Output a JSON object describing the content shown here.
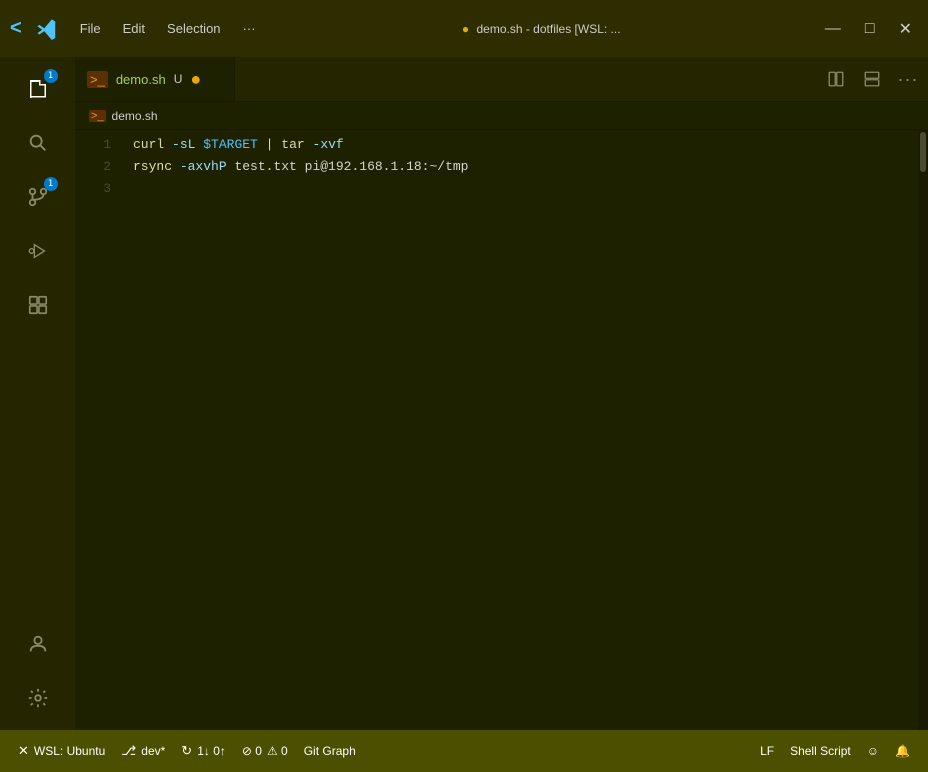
{
  "titlebar": {
    "logo": "⟩_",
    "menu": {
      "file": "File",
      "edit": "Edit",
      "selection": "Selection",
      "more": "···"
    },
    "title_dot": "●",
    "title_text": "demo.sh - dotfiles [WSL: ...",
    "controls": {
      "minimize": "—",
      "maximize": "□",
      "close": "✕"
    }
  },
  "activity_bar": {
    "icons": [
      {
        "name": "explorer-icon",
        "symbol": "📄",
        "badge": null
      },
      {
        "name": "search-icon",
        "symbol": "🔍",
        "badge": null
      },
      {
        "name": "source-control-icon",
        "symbol": "⑂",
        "badge": "1"
      },
      {
        "name": "run-debug-icon",
        "symbol": "▷",
        "badge": null
      },
      {
        "name": "extensions-icon",
        "symbol": "⋯",
        "badge": null
      }
    ],
    "bottom_icons": [
      {
        "name": "account-icon",
        "symbol": "👤",
        "badge": null
      },
      {
        "name": "settings-icon",
        "symbol": "⚙",
        "badge": null
      }
    ]
  },
  "tab_bar": {
    "tab": {
      "icon": ">_",
      "name": "demo.sh",
      "badge": "U",
      "dot": "●"
    },
    "actions": {
      "split_editor": "⧉",
      "layout": "⊞",
      "more": "···"
    }
  },
  "breadcrumb": {
    "icon": ">_",
    "filename": "demo.sh"
  },
  "editor": {
    "lines": [
      {
        "number": "1",
        "tokens": [
          {
            "type": "cmd",
            "text": "curl"
          },
          {
            "type": "plain",
            "text": " "
          },
          {
            "type": "flag",
            "text": "-sL"
          },
          {
            "type": "plain",
            "text": " "
          },
          {
            "type": "var",
            "text": "$TARGET"
          },
          {
            "type": "plain",
            "text": " "
          },
          {
            "type": "pipe",
            "text": "|"
          },
          {
            "type": "plain",
            "text": " "
          },
          {
            "type": "cmd",
            "text": "tar"
          },
          {
            "type": "plain",
            "text": " "
          },
          {
            "type": "flag",
            "text": "-xvf"
          }
        ]
      },
      {
        "number": "2",
        "tokens": [
          {
            "type": "cmd",
            "text": "rsync"
          },
          {
            "type": "plain",
            "text": " "
          },
          {
            "type": "flag",
            "text": "-axvhP"
          },
          {
            "type": "plain",
            "text": " test.txt pi@192.168.1.18:~/tmp"
          }
        ]
      },
      {
        "number": "3",
        "tokens": []
      }
    ]
  },
  "status_bar": {
    "wsl": "WSL: Ubuntu",
    "branch": "dev*",
    "sync": "1↓ 0↑",
    "errors": "⊘ 0 ⚠ 0",
    "git_graph": "Git Graph",
    "eol": "LF",
    "language": "Shell Script",
    "bell_icon": "🔔",
    "branch_icon": "⎇"
  }
}
